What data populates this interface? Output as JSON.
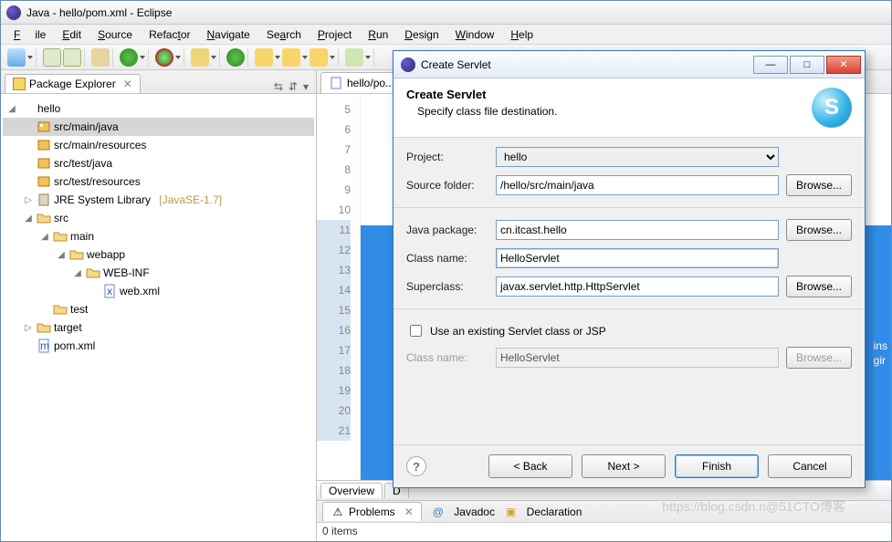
{
  "window": {
    "title": "Java - hello/pom.xml - Eclipse"
  },
  "menu": {
    "file": "File",
    "edit": "Edit",
    "source": "Source",
    "refactor": "Refactor",
    "navigate": "Navigate",
    "search": "Search",
    "project": "Project",
    "run": "Run",
    "design": "Design",
    "window": "Window",
    "help": "Help"
  },
  "package_explorer": {
    "title": "Package Explorer",
    "project": "hello",
    "nodes": {
      "src_main_java": "src/main/java",
      "src_main_resources": "src/main/resources",
      "src_test_java": "src/test/java",
      "src_test_resources": "src/test/resources",
      "jre": "JRE System Library",
      "jre_ver": "[JavaSE-1.7]",
      "src": "src",
      "main": "main",
      "webapp": "webapp",
      "webinf": "WEB-INF",
      "webxml": "web.xml",
      "test": "test",
      "target": "target",
      "pom": "pom.xml"
    }
  },
  "editor": {
    "tab": "hello/po...",
    "gutter": [
      "5",
      "6",
      "7",
      "8",
      "9",
      "10",
      "11",
      "12",
      "13",
      "14",
      "15",
      "16",
      "17",
      "18",
      "19",
      "20",
      "21"
    ],
    "plugins_hint_1": "ins",
    "plugins_hint_2": "gir",
    "bottom_tabs": {
      "overview": "Overview",
      "d": "D"
    }
  },
  "problems": {
    "tab_problems": "Problems",
    "tab_javadoc": "Javadoc",
    "tab_declaration": "Declaration",
    "status": "0 items"
  },
  "watermark": "https://blog.csdn.n@51CTO博客",
  "dialog": {
    "title": "Create Servlet",
    "heading": "Create Servlet",
    "subheading": "Specify class file destination.",
    "labels": {
      "project": "Project:",
      "source_folder": "Source folder:",
      "java_package": "Java package:",
      "class_name": "Class name:",
      "superclass": "Superclass:",
      "use_existing": "Use an existing Servlet class or JSP",
      "class_name2": "Class name:"
    },
    "values": {
      "project": "hello",
      "source_folder": "/hello/src/main/java",
      "java_package": "cn.itcast.hello",
      "class_name": "HelloServlet",
      "superclass": "javax.servlet.http.HttpServlet",
      "use_existing": false,
      "class_name2": "HelloServlet"
    },
    "buttons": {
      "browse": "Browse...",
      "back": "< Back",
      "next": "Next >",
      "finish": "Finish",
      "cancel": "Cancel",
      "help": "?"
    }
  }
}
